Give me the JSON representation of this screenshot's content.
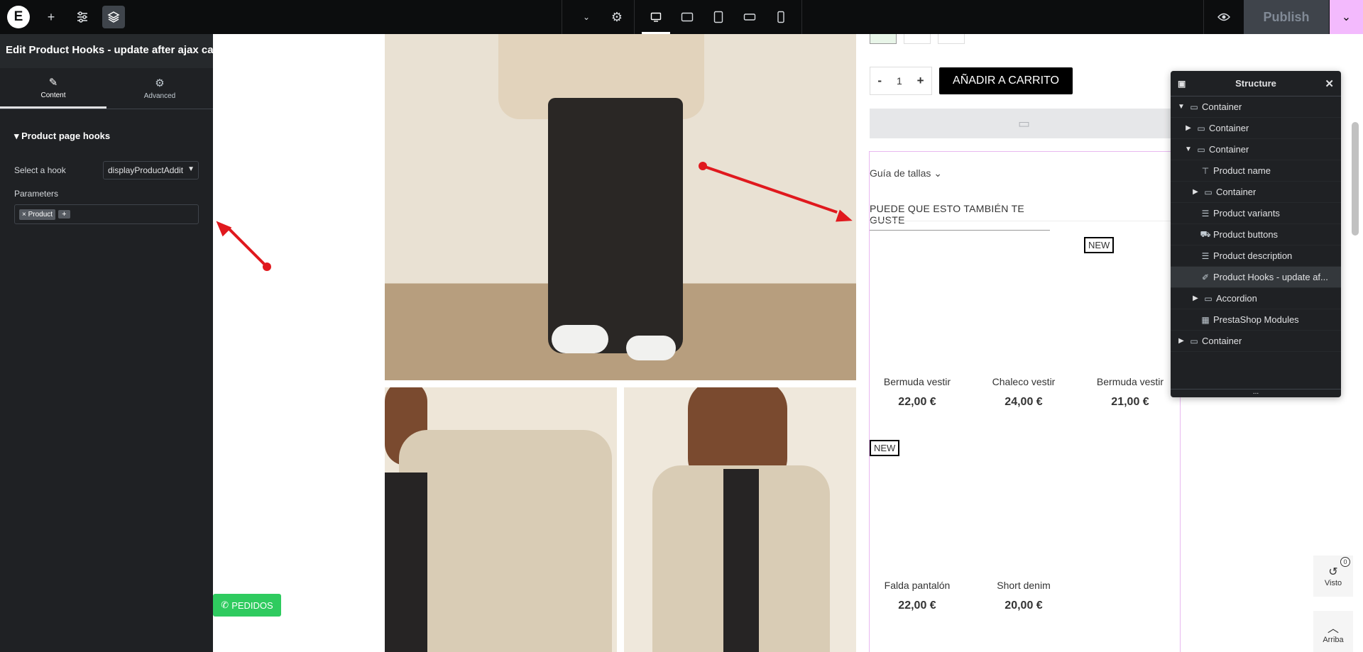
{
  "topbar": {
    "logo": "E",
    "add_icon": "+",
    "settings_icon": "⚙",
    "layers_icon": "≋",
    "publish_label": "Publish",
    "devices": [
      "desktop-icon",
      "tablet-landscape-icon",
      "tablet-icon",
      "mobile-landscape-icon",
      "mobile-icon"
    ]
  },
  "panel": {
    "title": "Edit Product Hooks - update after ajax call",
    "tab_content": "Content",
    "tab_advanced": "Advanced",
    "section": "Product page hooks",
    "hook_label": "Select a hook",
    "hook_value": "displayProductAddit",
    "params_label": "Parameters",
    "param_tag": "× Product",
    "param_add": "+"
  },
  "product": {
    "qty_minus": "-",
    "qty_value": "1",
    "qty_plus": "+",
    "add_to_cart": "AÑADIR A CARRITO",
    "size_guide": "Guía de tallas",
    "related_title": "PUEDE QUE ESTO TAMBIÉN TE GUSTE",
    "new_badge": "NEW",
    "related": [
      {
        "name": "Bermuda vestir",
        "price": "22,00 €"
      },
      {
        "name": "Chaleco vestir",
        "price": "24,00 €"
      },
      {
        "name": "Bermuda vestir",
        "price": "21,00 €"
      },
      {
        "name": "Falda pantalón",
        "price": "22,00 €"
      },
      {
        "name": "Short denim",
        "price": "20,00 €"
      }
    ]
  },
  "whatsapp_label": "PEDIDOS",
  "widgets": {
    "visto_label": "Visto",
    "visto_count": "0",
    "arriba_label": "Arriba"
  },
  "structure": {
    "title": "Structure",
    "items": [
      {
        "label": "Container"
      },
      {
        "label": "Container"
      },
      {
        "label": "Container"
      },
      {
        "label": "Product name"
      },
      {
        "label": "Container"
      },
      {
        "label": "Product variants"
      },
      {
        "label": "Product buttons"
      },
      {
        "label": "Product description"
      },
      {
        "label": "Product Hooks - update af..."
      },
      {
        "label": "Accordion"
      },
      {
        "label": "PrestaShop Modules"
      },
      {
        "label": "Container"
      }
    ],
    "footer": "..."
  },
  "colors": {
    "editor_dark": "#1f2124",
    "publish_accent": "#f3bafd",
    "annotation_arrow": "#e0191e",
    "whatsapp": "#2fcb5f"
  }
}
